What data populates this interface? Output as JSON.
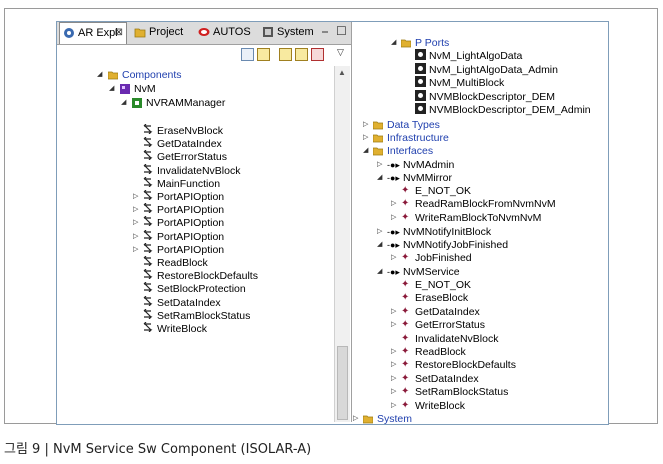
{
  "tabs": [
    {
      "label": "AR Expl",
      "close": "⊠",
      "active": true
    },
    {
      "label": "Project"
    },
    {
      "label": "AUTOS"
    },
    {
      "label": "System"
    }
  ],
  "window_buttons": [
    "⎯",
    "☐"
  ],
  "left_tree": {
    "components": "Components",
    "nvm": "NvM",
    "nvram_manager": "NVRAMManager",
    "entries": [
      {
        "label": "EraseNvBlock",
        "expand": false
      },
      {
        "label": "GetDataIndex",
        "expand": false
      },
      {
        "label": "GetErrorStatus",
        "expand": false
      },
      {
        "label": "InvalidateNvBlock",
        "expand": false
      },
      {
        "label": "MainFunction",
        "expand": false
      },
      {
        "label": "PortAPIOption",
        "expand": true
      },
      {
        "label": "PortAPIOption",
        "expand": true
      },
      {
        "label": "PortAPIOption",
        "expand": true
      },
      {
        "label": "PortAPIOption",
        "expand": true
      },
      {
        "label": "PortAPIOption",
        "expand": true
      },
      {
        "label": "ReadBlock",
        "expand": false
      },
      {
        "label": "RestoreBlockDefaults",
        "expand": false
      },
      {
        "label": "SetBlockProtection",
        "expand": false
      },
      {
        "label": "SetDataIndex",
        "expand": false
      },
      {
        "label": "SetRamBlockStatus",
        "expand": false
      },
      {
        "label": "WriteBlock",
        "expand": false
      }
    ]
  },
  "right_tree": {
    "p_ports": "P Ports",
    "ports": [
      "NvM_LightAlgoData",
      "NvM_LightAlgoData_Admin",
      "NvM_MultiBlock",
      "NVMBlockDescriptor_DEM",
      "NVMBlockDescriptor_DEM_Admin"
    ],
    "data_types": "Data Types",
    "infrastructure": "Infrastructure",
    "interfaces": "Interfaces",
    "nvm_admin": "NvMAdmin",
    "nvm_mirror": "NvMMirror",
    "mirror_items": [
      {
        "label": "E_NOT_OK",
        "expand": false
      },
      {
        "label": "ReadRamBlockFromNvmNvM",
        "expand": true
      },
      {
        "label": "WriteRamBlockToNvmNvM",
        "expand": true
      }
    ],
    "nvm_notify_init": "NvMNotifyInitBlock",
    "nvm_notify_job": "NvMNotifyJobFinished",
    "job_items": [
      {
        "label": "JobFinished",
        "expand": true
      }
    ],
    "nvm_service": "NvMService",
    "service_items": [
      {
        "label": "E_NOT_OK",
        "expand": false
      },
      {
        "label": "EraseBlock",
        "expand": false
      },
      {
        "label": "GetDataIndex",
        "expand": true
      },
      {
        "label": "GetErrorStatus",
        "expand": true
      },
      {
        "label": "InvalidateNvBlock",
        "expand": false
      },
      {
        "label": "ReadBlock",
        "expand": true
      },
      {
        "label": "RestoreBlockDefaults",
        "expand": true
      },
      {
        "label": "SetDataIndex",
        "expand": true
      },
      {
        "label": "SetRamBlockStatus",
        "expand": true
      },
      {
        "label": "WriteBlock",
        "expand": true
      }
    ],
    "system": "System"
  },
  "caption": "그림 9 | NvM Service Sw Component (ISOLAR-A)",
  "colors": {
    "blue_text": "#1f3fae",
    "folder": "#e0b030",
    "component": "#6a2ab0"
  },
  "icons": [
    "folder-icon",
    "component-icon",
    "runnable-icon",
    "port-icon",
    "interface-icon",
    "operation-icon",
    "expand-arrow-icon"
  ]
}
